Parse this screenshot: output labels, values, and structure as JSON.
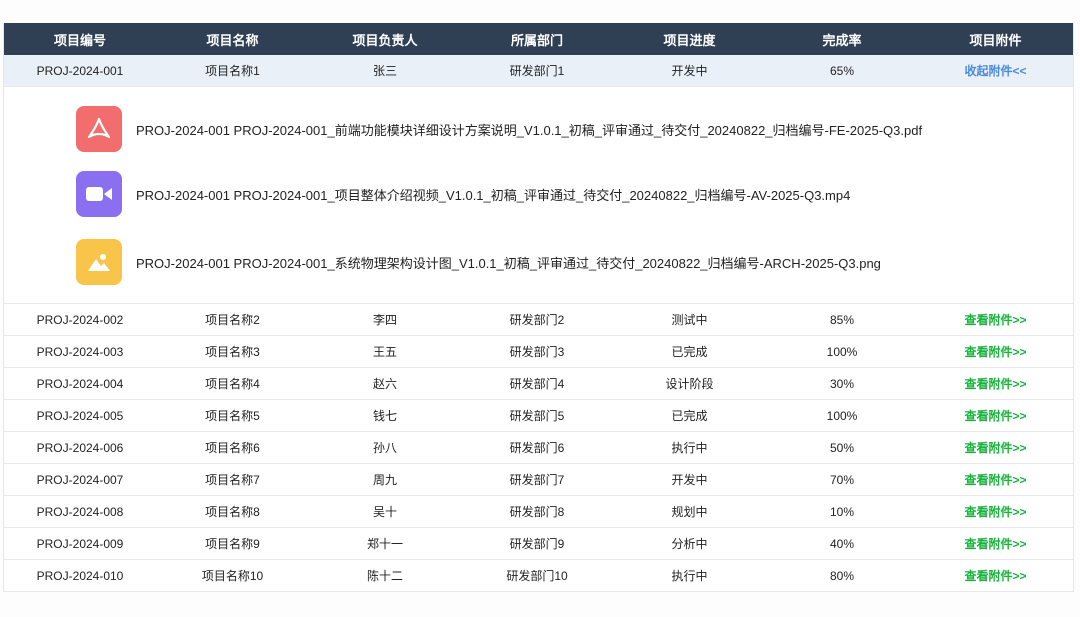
{
  "table": {
    "headers": [
      "项目编号",
      "项目名称",
      "项目负责人",
      "所属部门",
      "项目进度",
      "完成率",
      "项目附件"
    ],
    "expanded_row": {
      "id": "PROJ-2024-001",
      "name": "项目名称1",
      "owner": "张三",
      "dept": "研发部门1",
      "progress": "开发中",
      "rate": "65%",
      "action": "收起附件<<"
    },
    "attachments": [
      {
        "icon": "pdf-file-icon",
        "name": "PROJ-2024-001 PROJ-2024-001_前端功能模块详细设计方案说明_V1.0.1_初稿_评审通过_待交付_20240822_归档编号-FE-2025-Q3.pdf"
      },
      {
        "icon": "video-file-icon",
        "name": "PROJ-2024-001 PROJ-2024-001_项目整体介绍视频_V1.0.1_初稿_评审通过_待交付_20240822_归档编号-AV-2025-Q3.mp4"
      },
      {
        "icon": "image-file-icon",
        "name": "PROJ-2024-001 PROJ-2024-001_系统物理架构设计图_V1.0.1_初稿_评审通过_待交付_20240822_归档编号-ARCH-2025-Q3.png"
      }
    ],
    "rows": [
      {
        "id": "PROJ-2024-002",
        "name": "项目名称2",
        "owner": "李四",
        "dept": "研发部门2",
        "progress": "测试中",
        "rate": "85%",
        "action": "查看附件>>"
      },
      {
        "id": "PROJ-2024-003",
        "name": "项目名称3",
        "owner": "王五",
        "dept": "研发部门3",
        "progress": "已完成",
        "rate": "100%",
        "action": "查看附件>>"
      },
      {
        "id": "PROJ-2024-004",
        "name": "项目名称4",
        "owner": "赵六",
        "dept": "研发部门4",
        "progress": "设计阶段",
        "rate": "30%",
        "action": "查看附件>>"
      },
      {
        "id": "PROJ-2024-005",
        "name": "项目名称5",
        "owner": "钱七",
        "dept": "研发部门5",
        "progress": "已完成",
        "rate": "100%",
        "action": "查看附件>>"
      },
      {
        "id": "PROJ-2024-006",
        "name": "项目名称6",
        "owner": "孙八",
        "dept": "研发部门6",
        "progress": "执行中",
        "rate": "50%",
        "action": "查看附件>>"
      },
      {
        "id": "PROJ-2024-007",
        "name": "项目名称7",
        "owner": "周九",
        "dept": "研发部门7",
        "progress": "开发中",
        "rate": "70%",
        "action": "查看附件>>"
      },
      {
        "id": "PROJ-2024-008",
        "name": "项目名称8",
        "owner": "吴十",
        "dept": "研发部门8",
        "progress": "规划中",
        "rate": "10%",
        "action": "查看附件>>"
      },
      {
        "id": "PROJ-2024-009",
        "name": "项目名称9",
        "owner": "郑十一",
        "dept": "研发部门9",
        "progress": "分析中",
        "rate": "40%",
        "action": "查看附件>>"
      },
      {
        "id": "PROJ-2024-010",
        "name": "项目名称10",
        "owner": "陈十二",
        "dept": "研发部门10",
        "progress": "执行中",
        "rate": "80%",
        "action": "查看附件>>"
      }
    ]
  },
  "colors": {
    "header_bg": "#2f3f54",
    "expanded_row_bg": "#eaf0f7",
    "link_green": "#18b33c",
    "link_blue": "#4a8bdc",
    "pdf_icon": "#f26d6d",
    "video_icon": "#8a6ff0",
    "image_icon": "#f8c54a"
  }
}
